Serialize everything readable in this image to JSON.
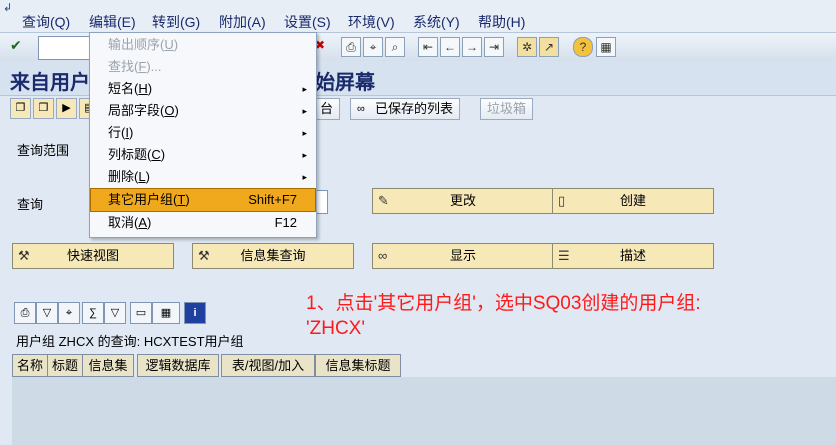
{
  "menubar": {
    "items": [
      "查询(Q)",
      "编辑(E)",
      "转到(G)",
      "附加(A)",
      "设置(S)",
      "环境(V)",
      "系统(Y)",
      "帮助(H)"
    ]
  },
  "toolbar": {
    "command_value": "",
    "icons": [
      "enter-icon",
      "save-icon",
      "back-icon",
      "exit-icon",
      "cancel-icon",
      "print-icon",
      "find-icon",
      "find-next-icon",
      "first-page-icon",
      "prev-page-icon",
      "next-page-icon",
      "last-page-icon",
      "new-session-icon",
      "shortcut-icon",
      "help-icon",
      "layout-icon"
    ]
  },
  "title": {
    "left": "来自用户",
    "right": "始屏幕"
  },
  "app_toolbar": {
    "btn1": "台",
    "saved_list": "已保存的列表",
    "trash": "垃圾箱"
  },
  "form": {
    "scope_label": "查询范围",
    "query_label": "查询",
    "change": "更改",
    "create": "创建",
    "quick_view": "快速视图",
    "infoset_query": "信息集查询",
    "display": "显示",
    "describe": "描述"
  },
  "list": {
    "group_text": "用户组 ZHCX 的查询: HCXTEST用户组",
    "columns": [
      "名称",
      "标题",
      "信息集",
      "逻辑数据库",
      "表/视图/加入",
      "信息集标题"
    ]
  },
  "annotation": {
    "line1": "1、点击'其它用户组'，选中SQ03创建的用户组:",
    "line2": "'ZHCX'"
  },
  "edit_menu": {
    "items": [
      {
        "label": "输出顺序",
        "key": "U",
        "shortcut": "",
        "disabled": true,
        "submenu": false
      },
      {
        "label": "查找",
        "key": "F",
        "suffix": "...",
        "shortcut": "",
        "disabled": true,
        "submenu": false
      },
      {
        "label": "短名",
        "key": "H",
        "shortcut": "",
        "disabled": false,
        "submenu": true
      },
      {
        "label": "局部字段",
        "key": "O",
        "shortcut": "",
        "disabled": false,
        "submenu": true
      },
      {
        "label": "行",
        "key": "I",
        "shortcut": "",
        "disabled": false,
        "submenu": true
      },
      {
        "label": "列标题",
        "key": "C",
        "shortcut": "",
        "disabled": false,
        "submenu": true
      },
      {
        "label": "删除",
        "key": "L",
        "shortcut": "",
        "disabled": false,
        "submenu": true
      },
      {
        "label": "其它用户组",
        "key": "T",
        "shortcut": "Shift+F7",
        "disabled": false,
        "submenu": false,
        "highlighted": true
      },
      {
        "label": "取消",
        "key": "A",
        "shortcut": "F12",
        "disabled": false,
        "submenu": false
      }
    ]
  },
  "colors": {
    "accent": "#f0a91c",
    "annotation": "#ff1a1a",
    "button_face": "#f7e8b8"
  }
}
